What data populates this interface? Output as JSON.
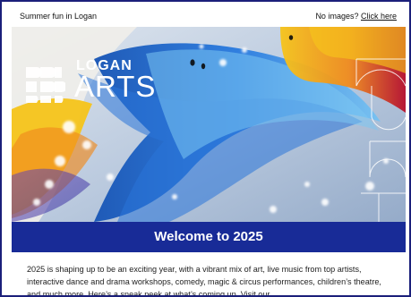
{
  "preheader": {
    "left_text": "Summer fun in Logan",
    "right_text": "No images?",
    "right_link": "Click here"
  },
  "hero": {
    "logo": {
      "top": "LOGAN",
      "main": "ARTS",
      "mark_icon": "logan-arts-mark-icon"
    },
    "background": "abstract-mural-image",
    "accent_colors": [
      "#f6c41a",
      "#f08a1d",
      "#1e64c2",
      "#4aa9df",
      "#b60e2d",
      "#f5f7fb"
    ]
  },
  "welcome": {
    "title": "Welcome to 2025",
    "bg": "#182b97",
    "text_color": "#ffffff"
  },
  "intro": {
    "text": "2025 is shaping up to be an exciting year, with a vibrant mix of art, live music from top artists, interactive dance and drama workshops, comedy, magic & circus performances, children’s theatre, and much more. Here’s a sneak peek at what’s coming up. Visit our"
  }
}
